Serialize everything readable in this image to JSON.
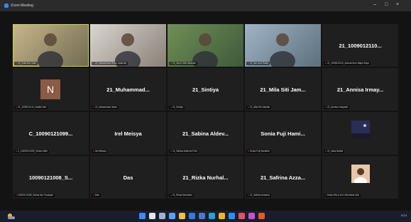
{
  "window": {
    "title": "Zoom Meeting",
    "controls": [
      "–",
      "□",
      "×"
    ]
  },
  "tiles": [
    {
      "type": "video",
      "label": "19_Yulia Nur Zaini",
      "active": true
    },
    {
      "type": "video",
      "label": "21_Muhammad Risky Jalaludin"
    },
    {
      "type": "video",
      "label": "21_Nurul Ulfa Hasanah"
    },
    {
      "type": "video",
      "label": "21_Nur Ana Rafiqi"
    },
    {
      "type": "name",
      "name": "21_1009012110...",
      "label": "21_1009012110_Ahmad Ibnu Najmi Anjar"
    },
    {
      "type": "initial",
      "initial": "N",
      "label": "21_1009012110_Nadila Sari"
    },
    {
      "type": "name",
      "name": "21_Muhammad...",
      "label": "21_Muhammad Ilham"
    },
    {
      "type": "name",
      "name": "21_Sintiya",
      "label": "21_Sintiya"
    },
    {
      "type": "name",
      "name": "21_Mila Siti Jam...",
      "label": "21_Mila Siti Jamilah"
    },
    {
      "type": "name",
      "name": "21_Annisa Irmay...",
      "label": "21_Annisa Irmayanti"
    },
    {
      "type": "name",
      "name": "C_10090121099...",
      "label": "C_10090121099_Vivian Arifin"
    },
    {
      "type": "name",
      "name": "Irel Meisya",
      "label": "Irel Meisya"
    },
    {
      "type": "name",
      "name": "21_Sabina Aldev...",
      "label": "21_Sabina Aldevira Putri"
    },
    {
      "type": "name",
      "name": "Sonia Fuji Hami...",
      "label": "Sonia Fuji Hamidah"
    },
    {
      "type": "thumb-night",
      "label": "21_Alisa Nabila"
    },
    {
      "type": "name",
      "name": "10090121008_S...",
      "label": "10090121008_Salma Nur Fauziyah"
    },
    {
      "type": "name",
      "name": "Das",
      "label": "Das"
    },
    {
      "type": "name",
      "name": "21_Rizka Nurhal...",
      "label": "21_Rizka Nurhaliza"
    },
    {
      "type": "name",
      "name": "21_Safrina Azza...",
      "label": "21_Safrina Azzahra"
    },
    {
      "type": "thumb-avatar",
      "label": "Kelas Bhs & Kel Ulfa Maria Ulfa"
    }
  ],
  "colors": {
    "stage_bg": "#131313",
    "tile_bg": "#1f1f1f",
    "active_outline": "#c8d64a",
    "titlebar_bg": "#2b2b2b",
    "taskbar_bg": "#1a1e2a",
    "initial_bg": "#8a5b45"
  },
  "taskbar": {
    "weather_temp": "29°C",
    "icons": [
      "start-icon",
      "search-icon",
      "task-view-icon",
      "widgets-icon",
      "file-explorer-icon",
      "mail-icon",
      "store-icon",
      "edge-icon",
      "chrome-icon",
      "zoom-icon",
      "photos-icon",
      "app-icon",
      "office-icon"
    ],
    "tray_time": "8:13",
    "tray_date": "21/11/2022"
  }
}
